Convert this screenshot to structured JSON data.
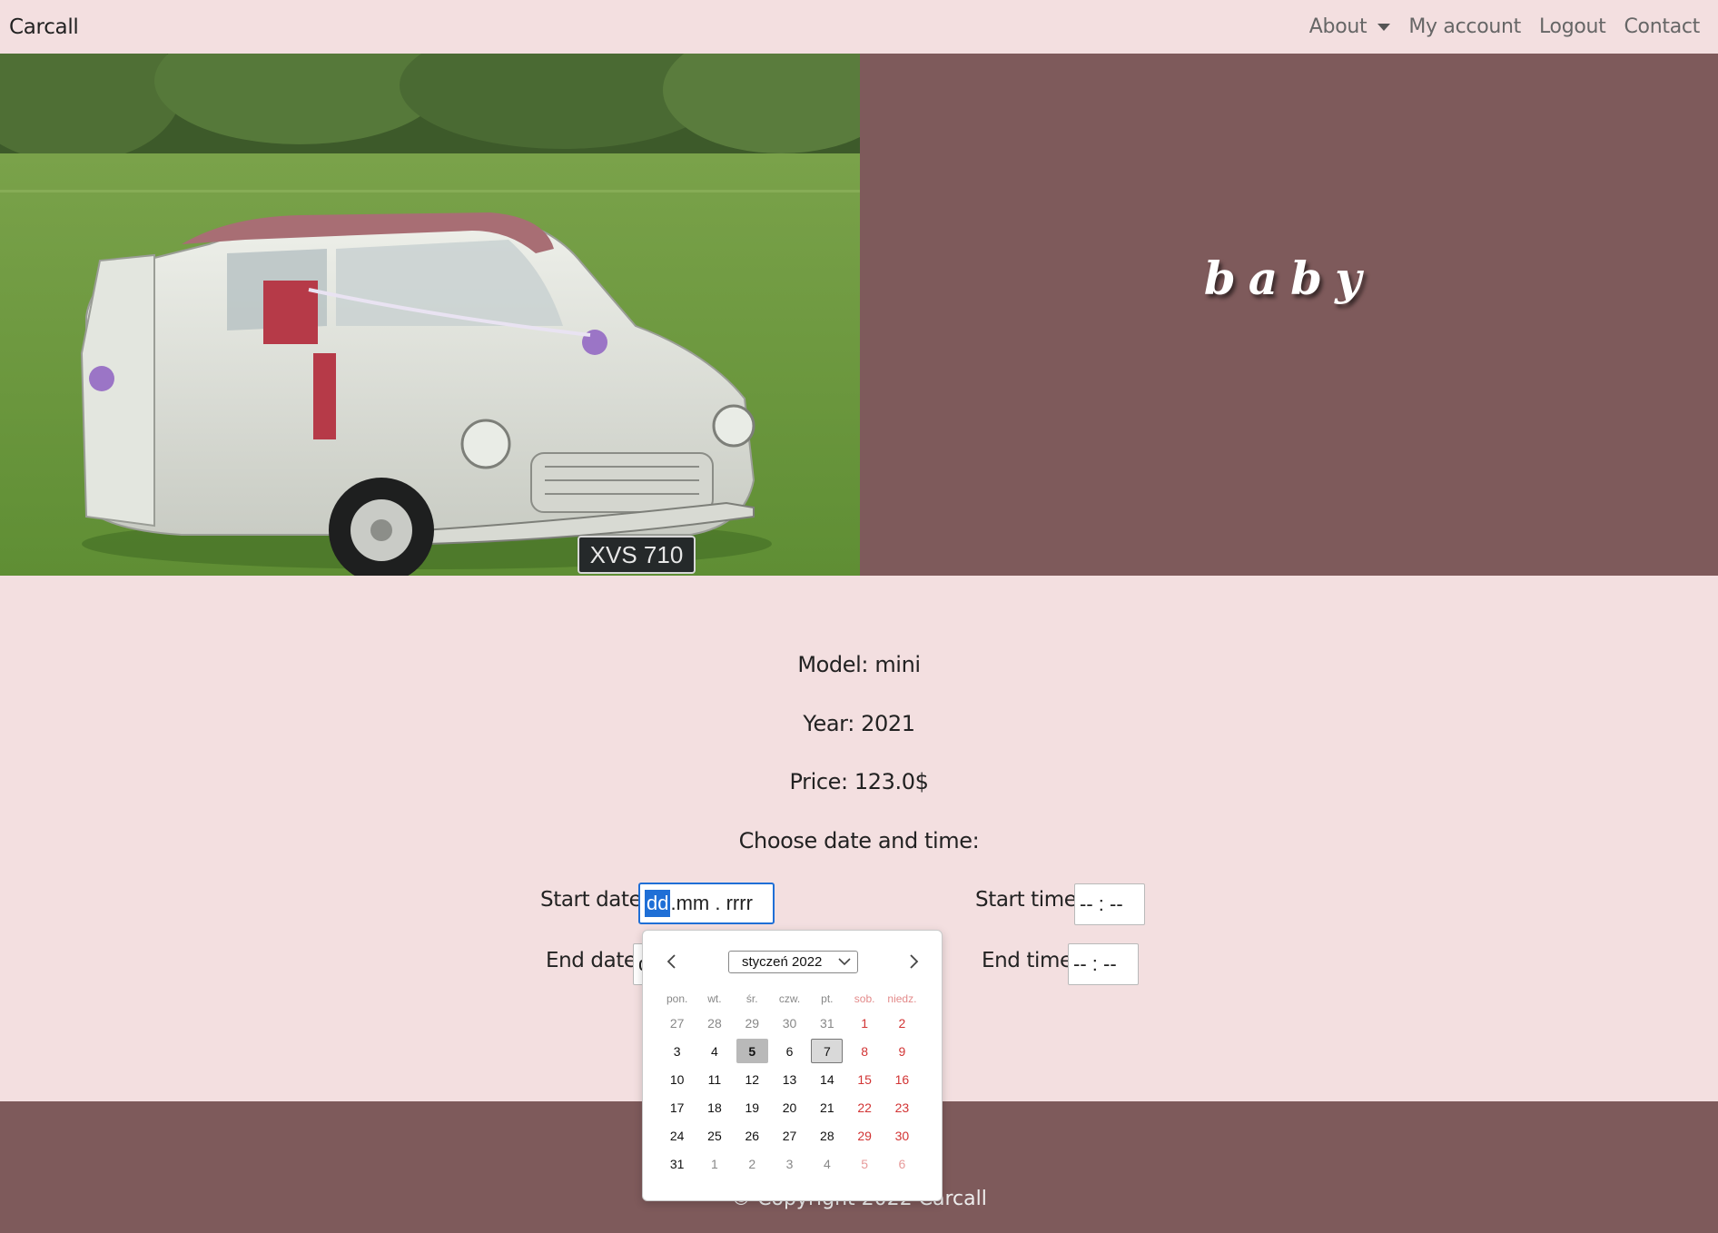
{
  "theme": {
    "colors": {
      "page_bg": "#f3dfe0",
      "accent_panel": "#7e5a5b",
      "nav_text": "#666666",
      "focus_border": "#1f6fd6",
      "weekend_red": "#d23434"
    }
  },
  "navbar": {
    "brand": "Carcall",
    "links": [
      {
        "label": "About",
        "icon": "caret-down-icon"
      },
      {
        "label": "My account"
      },
      {
        "label": "Logout"
      },
      {
        "label": "Contact"
      }
    ]
  },
  "hero": {
    "image_plate": "XVS 710",
    "title": "baby"
  },
  "car": {
    "model_text": "Model: mini",
    "year_text": "Year: 2021",
    "price_text": "Price: 123.0$",
    "choose_text": "Choose date and time:"
  },
  "form": {
    "start_date_label": "Start date:",
    "start_date_placeholder": {
      "dd": "dd",
      "rest": ".mm . rrrr"
    },
    "end_date_label": "End date:",
    "end_date_value": "d",
    "start_time_label": "Start time:",
    "start_time_placeholder": "-- : --",
    "end_time_label": "End time:",
    "end_time_placeholder": "-- : --"
  },
  "datepicker": {
    "month_label": "styczeń 2022",
    "weekdays": [
      "pon.",
      "wt.",
      "śr.",
      "czw.",
      "pt.",
      "sob.",
      "niedz."
    ],
    "weeks": [
      [
        {
          "d": "27",
          "o": true
        },
        {
          "d": "28",
          "o": true
        },
        {
          "d": "29",
          "o": true
        },
        {
          "d": "30",
          "o": true
        },
        {
          "d": "31",
          "o": true
        },
        {
          "d": "1"
        },
        {
          "d": "2"
        }
      ],
      [
        {
          "d": "3"
        },
        {
          "d": "4"
        },
        {
          "d": "5",
          "today": true
        },
        {
          "d": "6"
        },
        {
          "d": "7",
          "selected": true
        },
        {
          "d": "8"
        },
        {
          "d": "9"
        }
      ],
      [
        {
          "d": "10"
        },
        {
          "d": "11"
        },
        {
          "d": "12"
        },
        {
          "d": "13"
        },
        {
          "d": "14"
        },
        {
          "d": "15"
        },
        {
          "d": "16"
        }
      ],
      [
        {
          "d": "17"
        },
        {
          "d": "18"
        },
        {
          "d": "19"
        },
        {
          "d": "20"
        },
        {
          "d": "21"
        },
        {
          "d": "22"
        },
        {
          "d": "23"
        }
      ],
      [
        {
          "d": "24"
        },
        {
          "d": "25"
        },
        {
          "d": "26"
        },
        {
          "d": "27"
        },
        {
          "d": "28"
        },
        {
          "d": "29"
        },
        {
          "d": "30"
        }
      ],
      [
        {
          "d": "31"
        },
        {
          "d": "1",
          "o": true
        },
        {
          "d": "2",
          "o": true
        },
        {
          "d": "3",
          "o": true
        },
        {
          "d": "4",
          "o": true
        },
        {
          "d": "5",
          "o": true
        },
        {
          "d": "6",
          "o": true
        }
      ]
    ]
  },
  "footer": {
    "copyright": "© Copyright 2022 Carcall"
  }
}
